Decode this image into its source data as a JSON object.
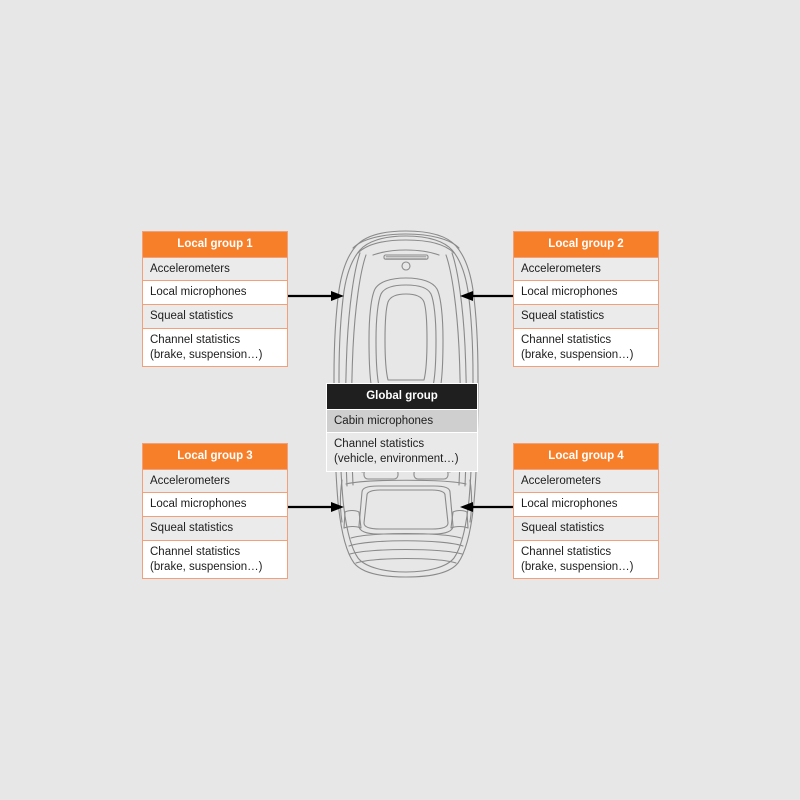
{
  "canvas": {
    "background_color": "#e7e7e7"
  },
  "palette": {
    "local_header_bg": "#f77f2a",
    "local_header_text": "#ffffff",
    "local_border": "#f2a07a",
    "global_header_bg": "#1f1f1f",
    "global_header_text": "#ffffff",
    "row_shade": "#ebebeb",
    "row_plain": "#ffffff",
    "arrow_color": "#000000",
    "car_line_color": "#8a8a8a"
  },
  "illustration": {
    "name": "car-top-view",
    "description": "Top-down outline drawing of a car"
  },
  "global_group": {
    "title": "Global group",
    "rows": [
      "Cabin microphones",
      "Channel statistics\n(vehicle, environment…)"
    ]
  },
  "local_groups": [
    {
      "title": "Local group 1",
      "position": "top-left",
      "rows": [
        "Accelerometers",
        "Local microphones",
        "Squeal statistics",
        "Channel statistics\n(brake, suspension…)"
      ]
    },
    {
      "title": "Local group 2",
      "position": "top-right",
      "rows": [
        "Accelerometers",
        "Local microphones",
        "Squeal statistics",
        "Channel statistics\n(brake, suspension…)"
      ]
    },
    {
      "title": "Local group 3",
      "position": "bottom-left",
      "rows": [
        "Accelerometers",
        "Local microphones",
        "Squeal statistics",
        "Channel statistics\n(brake, suspension…)"
      ]
    },
    {
      "title": "Local group 4",
      "position": "bottom-right",
      "rows": [
        "Accelerometers",
        "Local microphones",
        "Squeal statistics",
        "Channel statistics\n(brake, suspension…)"
      ]
    }
  ],
  "arrows": [
    {
      "name": "arrow-group1-to-car",
      "direction": "right"
    },
    {
      "name": "arrow-group2-to-car",
      "direction": "left"
    },
    {
      "name": "arrow-group3-to-car",
      "direction": "right"
    },
    {
      "name": "arrow-group4-to-car",
      "direction": "left"
    }
  ]
}
